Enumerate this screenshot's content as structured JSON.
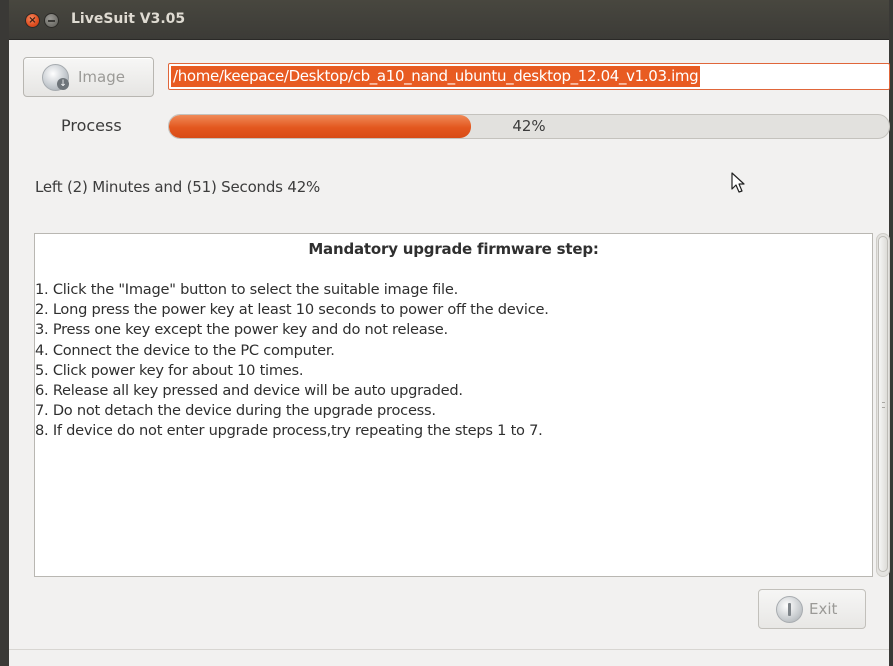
{
  "window": {
    "title": "LiveSuit V3.05",
    "close_symbol": "×"
  },
  "image_button": {
    "label": "Image",
    "icon": "disc-download-icon"
  },
  "path_field": {
    "value": "/home/keepace/Desktop/cb_a10_nand_ubuntu_desktop_12.04_v1.03.img"
  },
  "process": {
    "label": "Process",
    "percent": 42,
    "percent_text": "42%"
  },
  "status": {
    "text": "Left (2) Minutes and (51) Seconds  42%"
  },
  "instructions": {
    "heading": "Mandatory upgrade firmware step:",
    "steps": [
      "1. Click the \"Image\" button to select the suitable image file.",
      "2. Long press the power key at least 10 seconds to power off the device.",
      "3. Press one key except the power key and do not release.",
      "4. Connect the device to the PC computer.",
      "5. Click power key for about 10 times.",
      "6. Release all key pressed and device will be auto upgraded.",
      "7. Do not detach the device during the upgrade process.",
      "8. If device do not enter upgrade process,try repeating the steps 1 to 7."
    ]
  },
  "exit_button": {
    "label": "Exit",
    "icon": "power-icon"
  },
  "colors": {
    "accent": "#e85b22",
    "titlebar": "#3c3b37"
  }
}
